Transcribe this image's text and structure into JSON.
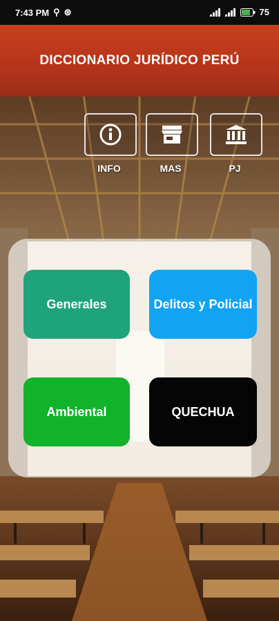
{
  "status_bar": {
    "time": "7:43 PM",
    "battery": "75"
  },
  "header": {
    "title": "DICCIONARIO JURÍDICO PERÚ"
  },
  "top_buttons": [
    {
      "label": "INFO",
      "icon": "info-circle-icon"
    },
    {
      "label": "MAS",
      "icon": "store-icon"
    },
    {
      "label": "PJ",
      "icon": "courthouse-icon"
    }
  ],
  "tiles": [
    {
      "label": "Generales",
      "color": "#1fa37b"
    },
    {
      "label": "Delitos y Policial",
      "color": "#12a3f2"
    },
    {
      "label": "Ambiental",
      "color": "#10b32a"
    },
    {
      "label": "QUECHUA",
      "color": "#050505"
    }
  ]
}
